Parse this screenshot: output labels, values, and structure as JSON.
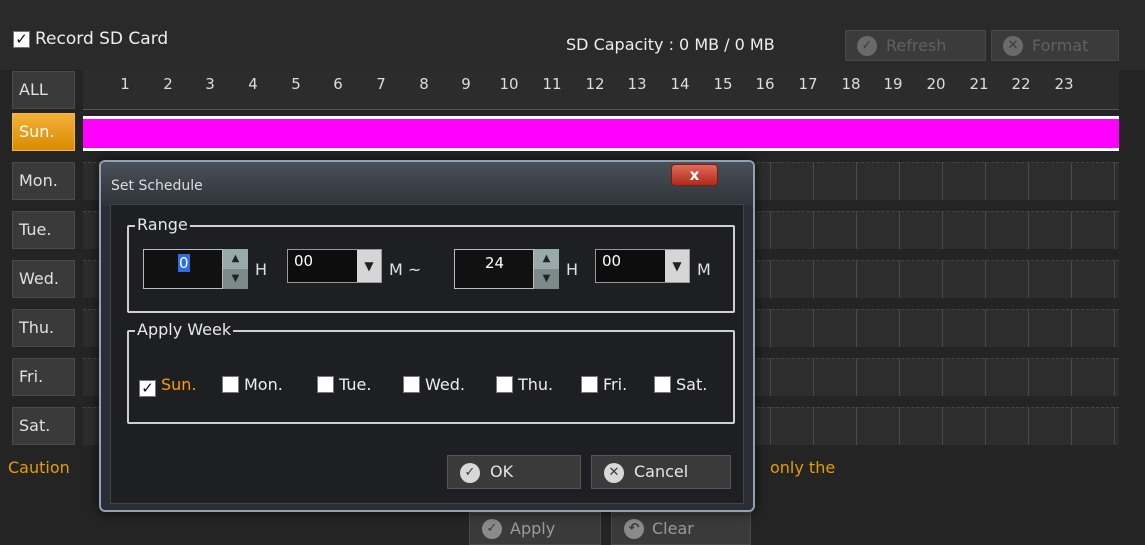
{
  "header": {
    "record_label": "Record SD Card",
    "record_checked": "✓",
    "sd_capacity": "SD Capacity : 0 MB / 0 MB",
    "refresh_label": "Refresh",
    "format_label": "Format"
  },
  "grid": {
    "all_label": "ALL",
    "days": [
      "Sun.",
      "Mon.",
      "Tue.",
      "Wed.",
      "Thu.",
      "Fri.",
      "Sat."
    ],
    "hours": [
      "1",
      "2",
      "3",
      "4",
      "5",
      "6",
      "7",
      "8",
      "9",
      "10",
      "11",
      "12",
      "13",
      "14",
      "15",
      "16",
      "17",
      "18",
      "19",
      "20",
      "21",
      "22",
      "23"
    ],
    "active_day": "Sun.",
    "fill_color": "#ff00ff"
  },
  "caution": {
    "left_text": "Caution",
    "right_text": "only the"
  },
  "bottom": {
    "apply_label": "Apply",
    "clear_label": "Clear"
  },
  "dialog": {
    "title": "Set Schedule",
    "close_label": "x",
    "range_legend": "Range",
    "start_hour": "0",
    "start_hour_unit": "H",
    "start_min": "00",
    "start_min_unit": "M ~",
    "end_hour": "24",
    "end_hour_unit": "H",
    "end_min": "00",
    "end_min_unit": "M",
    "apply_week_legend": "Apply Week",
    "weekdays": [
      "Sun.",
      "Mon.",
      "Tue.",
      "Wed.",
      "Thu.",
      "Fri.",
      "Sat."
    ],
    "checked_mark": "✓",
    "ok_label": "OK",
    "cancel_label": "Cancel"
  }
}
